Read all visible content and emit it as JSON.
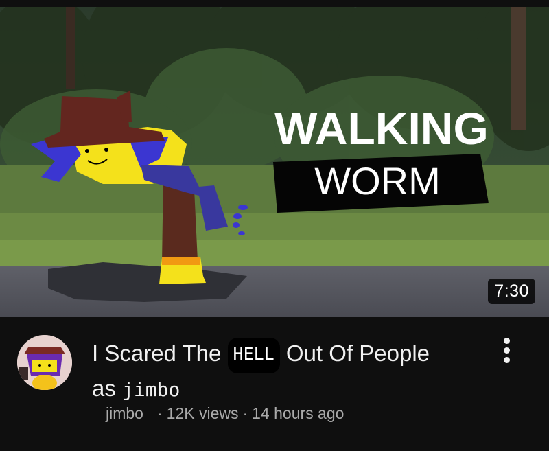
{
  "video": {
    "thumbnail_text_line1": "WALKING",
    "thumbnail_text_line2": "WORM",
    "duration": "7:30",
    "title_part1": "I Scared The",
    "title_censored": "HELL",
    "title_part2": "Out Of People",
    "title_part3": "as",
    "title_part4": "jimbo",
    "channel": "jimbo",
    "views": "12K views",
    "age": "14 hours ago",
    "separator": "·"
  },
  "icons": {
    "more": "more-vertical-icon",
    "avatar": "channel-avatar"
  },
  "colors": {
    "background": "#0f0f0f",
    "title": "#f1f1f1",
    "meta": "#aaaaaa",
    "duration_bg": "#000000"
  }
}
